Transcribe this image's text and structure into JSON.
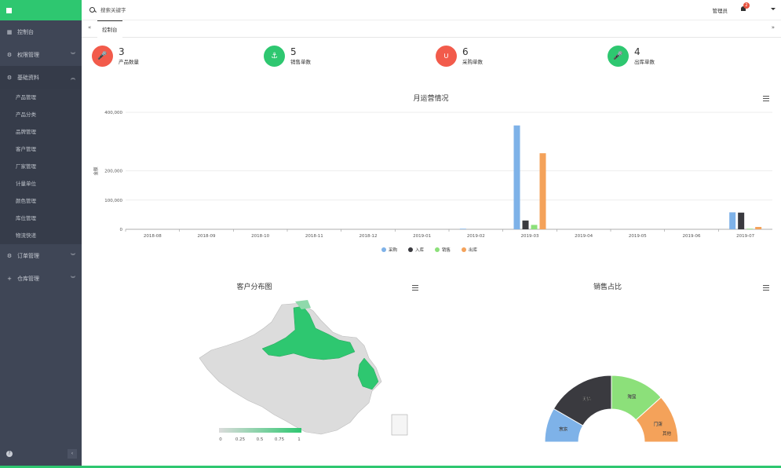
{
  "sidebar": {
    "items": [
      {
        "label": "控制台",
        "icon": "dashboard-icon"
      },
      {
        "label": "权限管理",
        "icon": "cogs-icon"
      },
      {
        "label": "基础资料",
        "icon": "cogs-icon"
      },
      {
        "label": "订单管理",
        "icon": "cogs-icon"
      },
      {
        "label": "仓库管理",
        "icon": "plus-icon"
      }
    ],
    "basic_sub": [
      "产品管理",
      "产品分类",
      "品牌管理",
      "客户管理",
      "厂家管理",
      "计量单位",
      "颜色管理",
      "库位管理",
      "物流快递"
    ]
  },
  "topbar": {
    "search_placeholder": "搜索关键字",
    "user": "管理员",
    "badge": "2"
  },
  "tabs": {
    "active": "控制台",
    "left_arrow": "«",
    "right_arrow": "»"
  },
  "stats": [
    {
      "num": "3",
      "label": "产品数量",
      "color": "#f25b4b"
    },
    {
      "num": "5",
      "label": "销售单数",
      "color": "#2ec770"
    },
    {
      "num": "6",
      "label": "采购单数",
      "color": "#f25b4b"
    },
    {
      "num": "4",
      "label": "出库单数",
      "color": "#2ec770"
    }
  ],
  "chart_data": [
    {
      "type": "bar",
      "title": "月运营情况",
      "ylabel": "金额",
      "categories": [
        "2018-08",
        "2018-09",
        "2018-10",
        "2018-11",
        "2018-12",
        "2019-01",
        "2019-02",
        "2019-03",
        "2019-04",
        "2019-05",
        "2019-06",
        "2019-07"
      ],
      "yticks": [
        "0",
        "100,000",
        "200,000",
        "400,000"
      ],
      "ylim": [
        0,
        400000
      ],
      "series": [
        {
          "name": "采购",
          "color": "#7eb2e8",
          "values": [
            0,
            0,
            0,
            0,
            0,
            0,
            2000,
            355000,
            0,
            0,
            0,
            58000
          ]
        },
        {
          "name": "入库",
          "color": "#3a3a3f",
          "values": [
            0,
            0,
            0,
            0,
            0,
            0,
            0,
            30000,
            0,
            0,
            0,
            57000
          ]
        },
        {
          "name": "销售",
          "color": "#8ce07a",
          "values": [
            0,
            0,
            0,
            0,
            0,
            0,
            0,
            15000,
            0,
            0,
            0,
            2000
          ]
        },
        {
          "name": "出库",
          "color": "#f4a25a",
          "values": [
            0,
            0,
            0,
            0,
            0,
            0,
            0,
            260000,
            0,
            0,
            0,
            8000
          ]
        }
      ],
      "legend": "bottom"
    },
    {
      "type": "map",
      "title": "客户分布图",
      "visual_map": [
        "0",
        "0.25",
        "0.5",
        "0.75",
        "1"
      ],
      "colors": {
        "low": "#dcdcdc",
        "high": "#2ec770"
      }
    },
    {
      "type": "pie",
      "title": "销售占比",
      "slices": [
        {
          "label": "京东",
          "value": 1,
          "color": "#7eb2e8"
        },
        {
          "label": "天猫",
          "value": 2,
          "color": "#3a3a3f"
        },
        {
          "label": "淘宝",
          "value": 1.6,
          "color": "#8ce07a"
        },
        {
          "label": "门店",
          "value": 1.4,
          "color": "#f4a25a"
        }
      ],
      "extra_labels": [
        "其他"
      ]
    }
  ]
}
